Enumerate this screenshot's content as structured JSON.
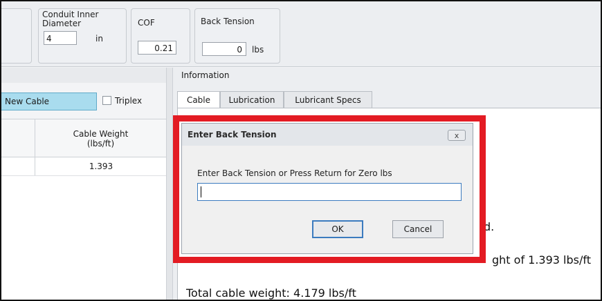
{
  "toolbar": {
    "conduit": {
      "label": "Conduit Inner Diameter",
      "value": "4",
      "unit": "in"
    },
    "cof": {
      "label": "COF",
      "value": "0.21"
    },
    "back_tension": {
      "label": "Back Tension",
      "value": "0",
      "unit": "lbs"
    }
  },
  "left_panel": {
    "new_cable_label": "New Cable",
    "triplex_label": "Triplex",
    "table": {
      "columns": [
        "Cable Weight\n(lbs/ft)"
      ],
      "rows": [
        {
          "cable_weight": "1.393"
        }
      ]
    }
  },
  "info_panel": {
    "title": "Information",
    "tabs": [
      {
        "label": "Cable",
        "active": true
      },
      {
        "label": "Lubrication",
        "active": false
      },
      {
        "label": "Lubricant Specs",
        "active": false
      }
    ],
    "content": {
      "line_partial_1": "d.",
      "line_partial_2": "ght of 1.393  lbs/ft",
      "total_weight": "Total cable weight: 4.179  lbs/ft"
    }
  },
  "dialog": {
    "title": "Enter Back Tension",
    "close_glyph": "x",
    "prompt": "Enter Back Tension or Press Return for Zero  lbs",
    "input_value": "",
    "ok_label": "OK",
    "cancel_label": "Cancel"
  },
  "colors": {
    "highlight_border": "#e31b23",
    "new_cable_button": "#a9dcee",
    "focus_blue": "#3b7bbf"
  }
}
